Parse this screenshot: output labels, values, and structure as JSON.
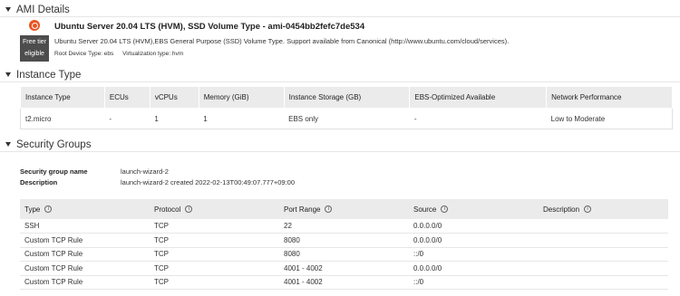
{
  "ami_details": {
    "section_title": "AMI Details",
    "title": "Ubuntu Server 20.04 LTS (HVM), SSD Volume Type - ami-0454bb2fefc7de534",
    "description": "Ubuntu Server 20.04 LTS (HVM),EBS General Purpose (SSD) Volume Type. Support available from Canonical (http://www.ubuntu.com/cloud/services).",
    "root_device": "Root Device Type: ebs",
    "virtualization": "Virtualization type: hvm",
    "free_tier_line1": "Free tier",
    "free_tier_line2": "eligible",
    "logo_icon": "ubuntu-logo-icon",
    "logo_color": "#e95420"
  },
  "instance_type": {
    "section_title": "Instance Type",
    "headers": [
      "Instance Type",
      "ECUs",
      "vCPUs",
      "Memory (GiB)",
      "Instance Storage (GB)",
      "EBS-Optimized Available",
      "Network Performance"
    ],
    "row": [
      "t2.micro",
      "-",
      "1",
      "1",
      "EBS only",
      "-",
      "Low to Moderate"
    ]
  },
  "security_groups": {
    "section_title": "Security Groups",
    "name_label": "Security group name",
    "name_value": "launch-wizard-2",
    "desc_label": "Description",
    "desc_value": "launch-wizard-2 created 2022-02-13T00:49:07.777+09:00",
    "headers": [
      "Type",
      "Protocol",
      "Port Range",
      "Source",
      "Description"
    ],
    "rules": [
      [
        "SSH",
        "TCP",
        "22",
        "0.0.0.0/0",
        ""
      ],
      [
        "Custom TCP Rule",
        "TCP",
        "8080",
        "0.0.0.0/0",
        ""
      ],
      [
        "Custom TCP Rule",
        "TCP",
        "8080",
        "::/0",
        ""
      ],
      [
        "Custom TCP Rule",
        "TCP",
        "4001 - 4002",
        "0.0.0.0/0",
        ""
      ],
      [
        "Custom TCP Rule",
        "TCP",
        "4001 - 4002",
        "::/0",
        ""
      ]
    ],
    "info_icon": "i"
  }
}
